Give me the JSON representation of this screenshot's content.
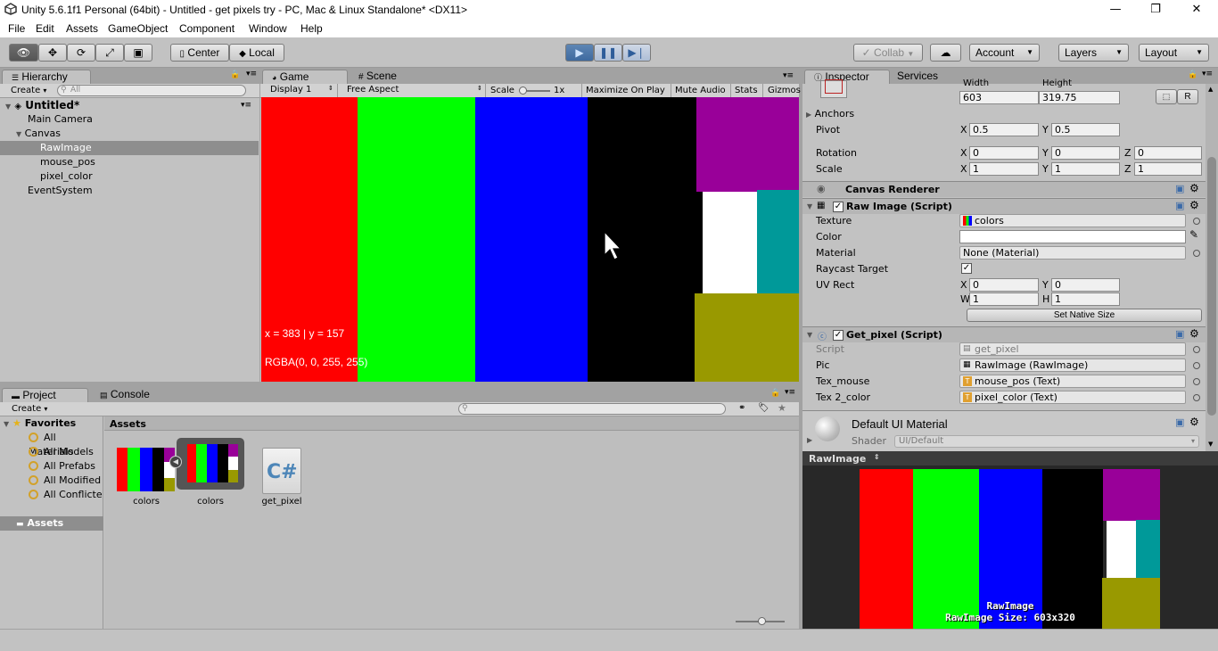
{
  "window": {
    "title": "Unity 5.6.1f1 Personal (64bit) - Untitled - get pixels try - PC, Mac & Linux Standalone* <DX11>",
    "minimize": "—",
    "restore": "❐",
    "close": "✕"
  },
  "menu": [
    "File",
    "Edit",
    "Assets",
    "GameObject",
    "Component",
    "Window",
    "Help"
  ],
  "toolbar": {
    "center": "Center",
    "local": "Local",
    "collab": "Collab",
    "account": "Account",
    "layers": "Layers",
    "layout": "Layout"
  },
  "hierarchy": {
    "tab": "Hierarchy",
    "create": "Create",
    "search_placeholder": "All",
    "scene": "Untitled*",
    "items": [
      "Main Camera",
      "Canvas",
      "RawImage",
      "mouse_pos",
      "pixel_color",
      "EventSystem"
    ]
  },
  "game": {
    "tab_game": "Game",
    "tab_scene": "Scene",
    "display": "Display 1",
    "aspect": "Free Aspect",
    "scale_label": "Scale",
    "scale_value": "1x",
    "maximize": "Maximize On Play",
    "mute": "Mute Audio",
    "stats": "Stats",
    "gizmos": "Gizmos",
    "overlay_pos": "x = 383 | y = 157",
    "overlay_rgba": "RGBA(0, 0, 255, 255)",
    "colors": {
      "red": "#ff0000",
      "green": "#00ff00",
      "blue": "#0000ff",
      "black": "#000000",
      "purple": "#990099",
      "white": "#ffffff",
      "teal": "#009999",
      "olive": "#999900"
    }
  },
  "project": {
    "tab_project": "Project",
    "tab_console": "Console",
    "create": "Create",
    "favorites": "Favorites",
    "favorites_items": [
      "All Materials",
      "All Models",
      "All Prefabs",
      "All Modified",
      "All Conflicte"
    ],
    "assets_folder": "Assets",
    "assets_header": "Assets",
    "assets": [
      "colors",
      "colors",
      "get_pixel"
    ],
    "cs_label": "C#"
  },
  "inspector": {
    "tab_inspector": "Inspector",
    "tab_services": "Services",
    "width_label": "Width",
    "height_label": "Height",
    "width": "603",
    "height": "319.75",
    "r_button": "R",
    "anchors": "Anchors",
    "pivot": "Pivot",
    "pivot_x": "0.5",
    "pivot_y": "0.5",
    "rotation": "Rotation",
    "rot_x": "0",
    "rot_y": "0",
    "rot_z": "0",
    "scale": "Scale",
    "scale_x": "1",
    "scale_y": "1",
    "scale_z": "1",
    "x": "X",
    "y": "Y",
    "z": "Z",
    "w": "W",
    "h": "H",
    "canvas_renderer": "Canvas Renderer",
    "raw_image": "Raw Image (Script)",
    "texture": "Texture",
    "texture_value": "colors",
    "color": "Color",
    "material": "Material",
    "material_value": "None (Material)",
    "raycast": "Raycast Target",
    "uv_rect": "UV Rect",
    "uv_x": "0",
    "uv_y": "0",
    "uv_w": "1",
    "uv_h": "1",
    "native_size": "Set Native Size",
    "get_pixel": "Get_pixel (Script)",
    "script": "Script",
    "script_value": "get_pixel",
    "pic": "Pic",
    "pic_value": "RawImage (RawImage)",
    "tex_mouse": "Tex_mouse",
    "tex_mouse_value": "mouse_pos (Text)",
    "tex2color": "Tex 2_color",
    "tex2color_value": "pixel_color (Text)",
    "default_material": "Default UI Material",
    "shader": "Shader",
    "shader_value": "UI/Default",
    "preview_title": "RawImage",
    "preview_name": "RawImage",
    "preview_size": "RawImage Size: 603x320"
  }
}
